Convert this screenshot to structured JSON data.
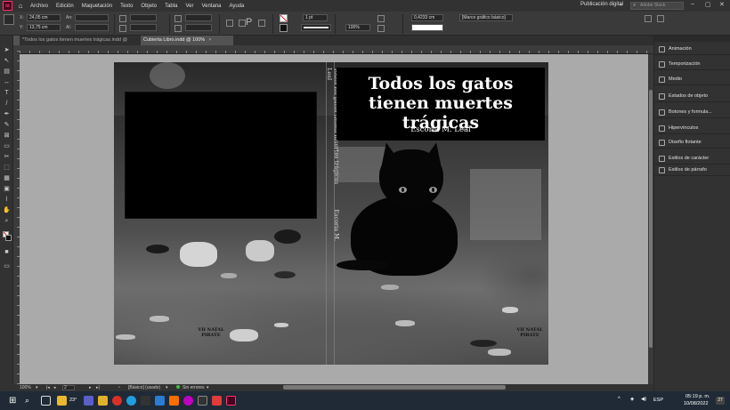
{
  "menubar": {
    "logo": "Id",
    "items": [
      "Archivo",
      "Edición",
      "Maquetación",
      "Texto",
      "Objeto",
      "Tabla",
      "Ver",
      "Ventana",
      "Ayuda"
    ],
    "workspace": "Publicación digital",
    "stock_placeholder": "Adobe Stock"
  },
  "controlbar": {
    "x_label": "X:",
    "x_value": "24,05 cm",
    "y_label": "Y:",
    "y_value": "13,75 cm",
    "w_label": "An:",
    "h_label": "Al:",
    "stroke_weight": "1 pt",
    "opacity": "100%",
    "dimension": "0,4233 cm",
    "frame_style": "[Marco gráfico básico]"
  },
  "tabs": [
    {
      "label": "*Todos los gatos tienen muertes trágicas.indd @ 100%"
    },
    {
      "label": "Cubierta Libro.indd @ 100%"
    }
  ],
  "cover": {
    "title": "Todos los gatos tienen muertes trágicas",
    "author": "Escoria M. Leal",
    "spine_text": "Todos los gatos tienen muertes trágicas",
    "spine_author": "Escoria M. Leal",
    "publisher_logo": "VII NATAL PIRATE"
  },
  "statusbar": {
    "zoom": "100%",
    "page": "2",
    "style": "[Básico] (usado)",
    "preflight": "Sin errores"
  },
  "panels": [
    {
      "label": "Animación",
      "icon": "animation-icon"
    },
    {
      "label": "Temporización",
      "icon": "timing-icon"
    },
    {
      "label": "Medio",
      "icon": "media-icon"
    },
    {
      "label": "Estados de objeto",
      "icon": "object-states-icon"
    },
    {
      "label": "Botones y formula...",
      "icon": "buttons-forms-icon"
    },
    {
      "label": "Hipervínculos",
      "icon": "hyperlinks-icon"
    },
    {
      "label": "Diseño flotante",
      "icon": "liquid-layout-icon"
    },
    {
      "label": "Estilos de carácter",
      "icon": "character-styles-icon"
    },
    {
      "label": "Estilos de párrafo",
      "icon": "paragraph-styles-icon"
    }
  ],
  "taskbar": {
    "temperature": "23°",
    "language": "ESP",
    "time": "05:19 p. m.",
    "date": "10/08/2022",
    "notifications": "27"
  }
}
